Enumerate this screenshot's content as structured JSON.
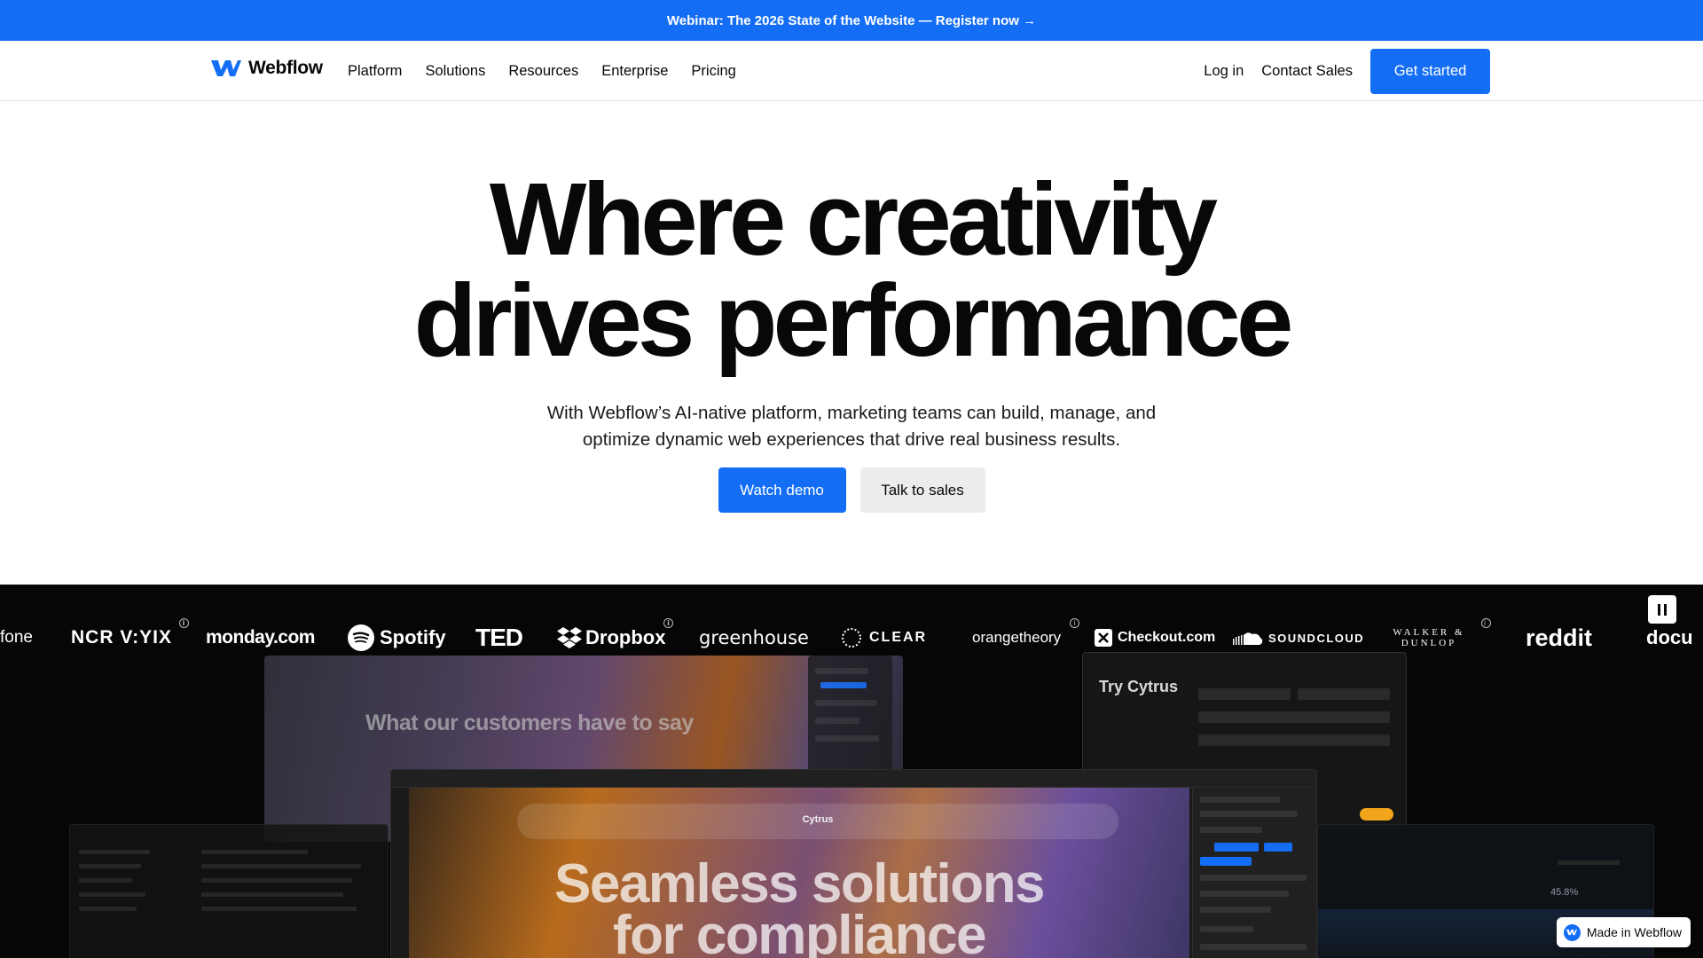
{
  "banner": {
    "text": "Webinar: The 2026 State of the Website — Register now →"
  },
  "nav": {
    "brand": "Webflow",
    "links": [
      "Platform",
      "Solutions",
      "Resources",
      "Enterprise",
      "Pricing"
    ],
    "login": "Log in",
    "contact": "Contact Sales",
    "cta": "Get started"
  },
  "hero": {
    "title_line1": "Where creativity",
    "title_line2": "drives performance",
    "subtitle_line1": "With Webflow’s AI-native platform, marketing teams can build, manage, and",
    "subtitle_line2": "optimize dynamic web experiences that drive real business results.",
    "cta_primary": "Watch demo",
    "cta_secondary": "Talk to sales"
  },
  "logos": [
    "fone",
    "NCR V:YIX",
    "monday.com",
    "Spotify",
    "TED",
    "Dropbox",
    "greenhouse",
    "CLEAR",
    "orangetheory",
    "Checkout.com",
    "SOUNDCLOUD",
    "WALKER & DUNLOP",
    "reddit",
    "docu"
  ],
  "showcase": {
    "back_heading": "What our customers have to say",
    "form_title": "Try Cytrus",
    "canvas_brand": "Cytrus",
    "canvas_heading_line1": "Seamless solutions",
    "canvas_heading_line2": "for compliance",
    "right_stat": "45.8%"
  },
  "badge": {
    "text": "Made in Webflow"
  },
  "colors": {
    "brand_blue": "#146ef5",
    "dark": "#080808",
    "light_button": "#ececec"
  }
}
